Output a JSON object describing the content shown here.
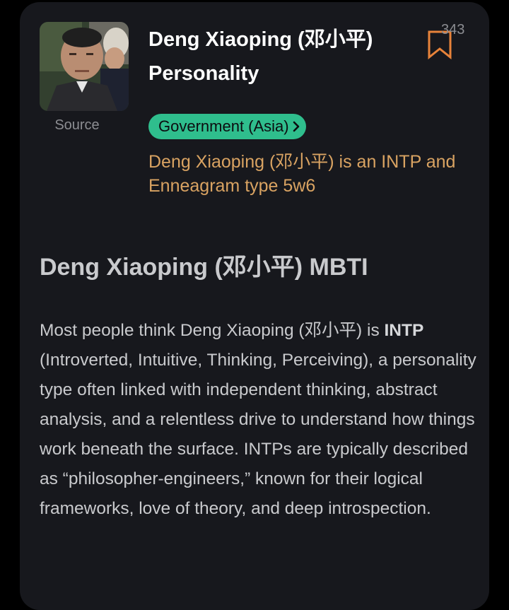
{
  "profile": {
    "title": "Deng Xiaoping (邓小平) Personality",
    "source_label": "Source",
    "bookmark_count": "343",
    "category": "Government (Asia)",
    "summary": "Deng Xiaoping (邓小平) is an INTP and Enneagram type 5w6"
  },
  "section": {
    "heading": "Deng Xiaoping (邓小平) MBTI",
    "description_lead": "Most people think Deng Xiaoping (邓小平) is ",
    "description_type": "INTP",
    "description_rest": " (Introverted, Intuitive, Thinking, Perceiving), a personality type often linked with independent thinking, abstract analysis, and a relentless drive to understand how things work beneath the surface. INTPs are typically described as “philosopher-engineers,” known for their logical frameworks, love of theory, and deep introspection."
  },
  "colors": {
    "card_background": "#17181d",
    "category_pill": "#2fbe8d",
    "summary_text": "#d9a362",
    "bookmark": "#e8833a"
  },
  "icons": {
    "bookmark": "bookmark-icon",
    "pill_chevron": "chevron-right-icon"
  }
}
